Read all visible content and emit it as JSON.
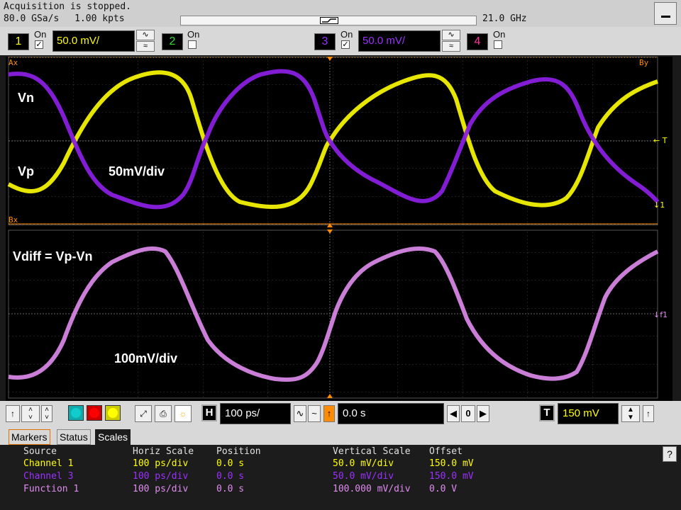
{
  "status": {
    "acquisition": "Acquisition is stopped.",
    "sample_rate": "80.0 GSa/s",
    "memory_depth": "1.00 kpts",
    "bandwidth": "21.0 GHz"
  },
  "channels": [
    {
      "number": "1",
      "on_label": "On",
      "checked": true,
      "scale": "50.0 mV/",
      "color": "#ffff00"
    },
    {
      "number": "2",
      "on_label": "On",
      "checked": false,
      "color": "#33dd33"
    },
    {
      "number": "3",
      "on_label": "On",
      "checked": true,
      "scale": "50.0 mV/",
      "color": "#9b30ff"
    },
    {
      "number": "4",
      "on_label": "On",
      "checked": false,
      "color": "#ff3399"
    }
  ],
  "screen": {
    "marker_ax": "Ax",
    "marker_bx": "Bx",
    "marker_by": "By",
    "trigger_marker": "T",
    "ch_marker": "1",
    "f_marker": "f1",
    "annotations": {
      "vn": "Vn",
      "vp": "Vp",
      "upper_scale": "50mV/div",
      "vdiff": "Vdiff = Vp-Vn",
      "lower_scale": "100mV/div"
    },
    "colors": {
      "ch1": "#ffff00",
      "ch3": "#8a1fe0",
      "f1": "#e08cf0",
      "grid": "#555555",
      "marker": "#ff8c00"
    }
  },
  "controls": {
    "horizontal_label": "H",
    "horizontal_scale": "100 ps/",
    "delay": "0.0 s",
    "nav_value": "0",
    "trigger_label": "T",
    "trigger_level": "150 mV"
  },
  "tabs": [
    "Markers",
    "Status",
    "Scales"
  ],
  "active_tab": "Scales",
  "scales": {
    "headers": [
      "Source",
      "Horiz Scale",
      "Position",
      "Vertical Scale",
      "Offset"
    ],
    "rows": [
      {
        "source": "Channel 1",
        "horiz": "100 ps/div",
        "position": "0.0 s",
        "vertical": "50.0 mV/div",
        "offset": "150.0 mV",
        "color": "#ffff00"
      },
      {
        "source": "Channel 3",
        "horiz": "100 ps/div",
        "position": "0.0 s",
        "vertical": "50.0 mV/div",
        "offset": "150.0 mV",
        "color": "#9b30ff"
      },
      {
        "source": "Function 1",
        "horiz": "100 ps/div",
        "position": "0.0 s",
        "vertical": "100.000 mV/div",
        "offset": "0.0 V",
        "color": "#e08cf0"
      }
    ]
  },
  "help_label": "?"
}
